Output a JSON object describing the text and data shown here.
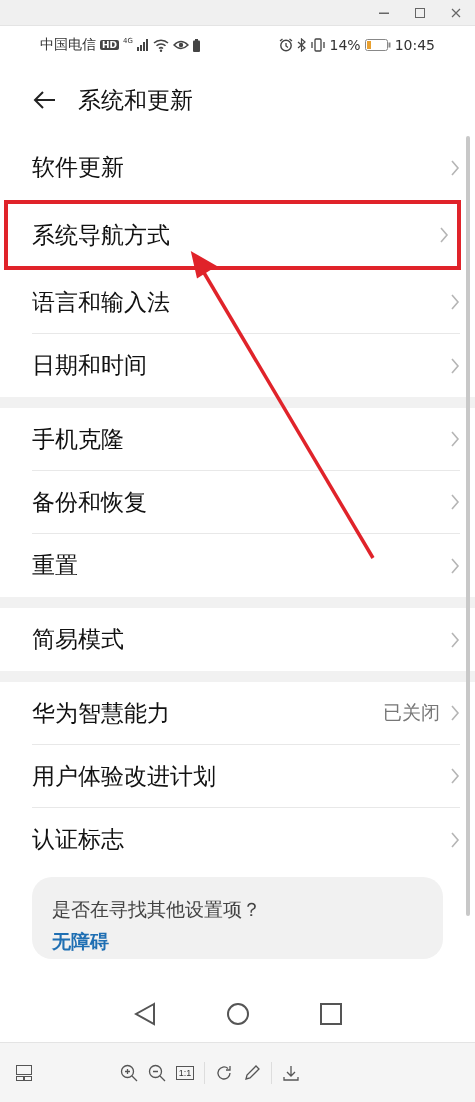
{
  "status_bar": {
    "carrier": "中国电信",
    "hd": "HD",
    "network": "4G",
    "battery": "14%",
    "time": "10:45"
  },
  "header": {
    "title": "系统和更新"
  },
  "groups": [
    {
      "items": [
        {
          "label": "软件更新",
          "highlighted": false
        },
        {
          "label": "系统导航方式",
          "highlighted": true
        },
        {
          "label": "语言和输入法",
          "highlighted": false
        },
        {
          "label": "日期和时间",
          "highlighted": false
        }
      ]
    },
    {
      "items": [
        {
          "label": "手机克隆",
          "highlighted": false
        },
        {
          "label": "备份和恢复",
          "highlighted": false
        },
        {
          "label": "重置",
          "highlighted": false
        }
      ]
    },
    {
      "items": [
        {
          "label": "简易模式",
          "highlighted": false
        }
      ]
    },
    {
      "items": [
        {
          "label": "华为智慧能力",
          "value": "已关闭",
          "highlighted": false
        },
        {
          "label": "用户体验改进计划",
          "highlighted": false
        },
        {
          "label": "认证标志",
          "highlighted": false
        }
      ]
    }
  ],
  "suggestion": {
    "question": "是否在寻找其他设置项？",
    "link": "无障碍"
  },
  "viewer_toolbar": {
    "actual_size": "1:1"
  }
}
